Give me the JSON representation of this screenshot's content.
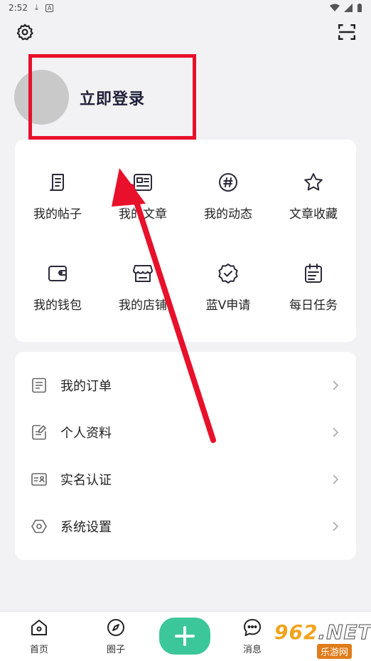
{
  "status_bar": {
    "time": "2:52",
    "icons": [
      "download-icon",
      "a-badge-icon",
      "wifi-icon",
      "signal-icon",
      "battery-icon"
    ]
  },
  "topbar": {
    "settings_icon": "gear-icon",
    "scan_icon": "scan-icon"
  },
  "profile": {
    "login_label": "立即登录"
  },
  "grid": [
    {
      "label": "我的帖子",
      "icon": "post-icon"
    },
    {
      "label": "我的文章",
      "icon": "article-icon"
    },
    {
      "label": "我的动态",
      "icon": "hashtag-icon"
    },
    {
      "label": "文章收藏",
      "icon": "star-icon"
    },
    {
      "label": "我的钱包",
      "icon": "wallet-icon"
    },
    {
      "label": "我的店铺",
      "icon": "store-icon"
    },
    {
      "label": "蓝V申请",
      "icon": "verified-icon"
    },
    {
      "label": "每日任务",
      "icon": "calendar-icon"
    }
  ],
  "list": [
    {
      "label": "我的订单",
      "icon": "order-icon"
    },
    {
      "label": "个人资料",
      "icon": "edit-doc-icon"
    },
    {
      "label": "实名认证",
      "icon": "id-card-icon"
    },
    {
      "label": "系统设置",
      "icon": "hexagon-icon"
    }
  ],
  "bottom_nav": [
    {
      "label": "首页",
      "icon": "home-icon"
    },
    {
      "label": "圈子",
      "icon": "compass-icon"
    },
    {
      "label": "",
      "icon": "plus-icon"
    },
    {
      "label": "消息",
      "icon": "chat-icon"
    }
  ],
  "watermark": {
    "top": "962",
    "net": ".NET",
    "bottom": "乐游网"
  },
  "colors": {
    "accent": "#3cc79a",
    "annotation": "#e8102a",
    "background": "#f2f2f4"
  }
}
